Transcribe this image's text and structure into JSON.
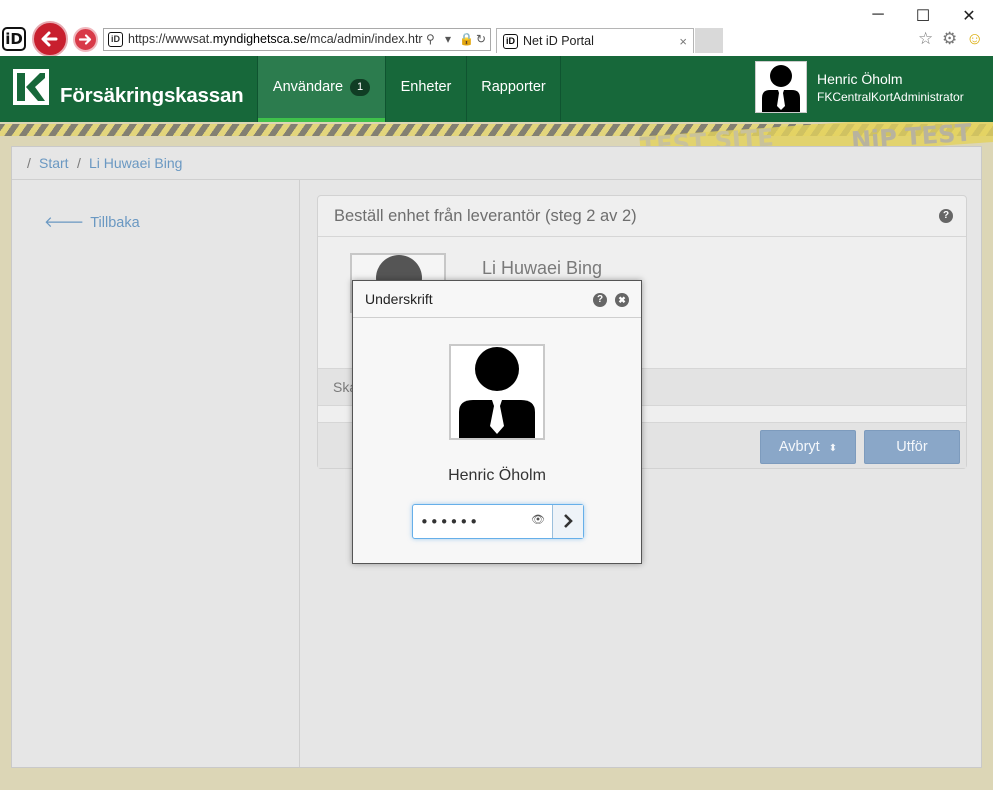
{
  "browser": {
    "url_prefix": "https://wwwsat.",
    "url_host": "myndighetsca.se",
    "url_path": "/mca/admin/index.htr",
    "tab_title": "Net iD Portal",
    "tab_close": "×",
    "app_icon_label": "iD",
    "window_controls": [
      "─",
      "☐",
      "✕"
    ],
    "toolbar_icons": [
      "star-icon",
      "gear-icon",
      "smiley-icon"
    ]
  },
  "app": {
    "brand": "Försäkringskassan",
    "nav": [
      {
        "label": "Användare",
        "badge": "1",
        "active": true
      },
      {
        "label": "Enheter",
        "active": false
      },
      {
        "label": "Rapporter",
        "active": false
      }
    ],
    "user": {
      "name": "Henric Öholm",
      "role": "FKCentralKortAdministrator"
    },
    "watermark": "NiP TEST S",
    "watermark2": "TEST SITE"
  },
  "breadcrumb": {
    "separator": "/",
    "items": [
      "Start",
      "Li Huwaei Bing"
    ]
  },
  "sidebar": {
    "back_label": "Tillbaka"
  },
  "panel": {
    "title": "Beställ enhet från leverantör (steg 2 av 2)",
    "person_name": "Li Huwaei Bing",
    "band_text": "Ska",
    "buttons": {
      "cancel": "Avbryt",
      "submit": "Utför"
    }
  },
  "modal": {
    "title": "Underskrift",
    "signer_name": "Henric Öholm",
    "password_value": "••••••",
    "help_icon": "?",
    "close_icon": "✖"
  },
  "colors": {
    "brand_green": "#17683a",
    "nav_active": "#2c7c4e",
    "nav_indicator": "#3fc14b",
    "link_blue": "#6a98c2",
    "button_blue": "#8aa7c8",
    "ie_red": "#c81f2e"
  }
}
